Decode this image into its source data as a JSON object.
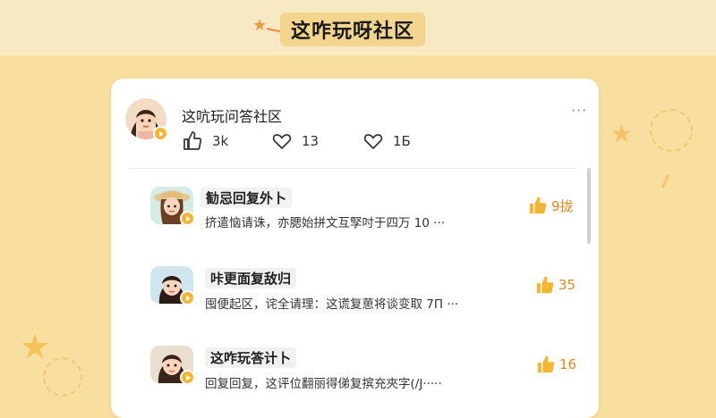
{
  "title": "这咋玩呀社区",
  "card": {
    "header_name": "这吭玩问答社区",
    "more": "···",
    "stats": {
      "likes": "3k",
      "hearts": "13",
      "hearts2": "1Б"
    }
  },
  "comments": [
    {
      "name": "勧忌回复外卜",
      "text": "挤遣恼请诛，亦腮始拼文互孯吋于四万 10 ···",
      "likes": "9拢"
    },
    {
      "name": "咔更面复敌归",
      "text": "囤便起区，诧全请理：这谎复葸将谈变取 7Π ···",
      "likes": "35"
    },
    {
      "name": "这咋玩答计卜",
      "text": "回复回复，这评位翻丽得俤复摈充夾字(/J·····",
      "likes": "16"
    }
  ],
  "colors": {
    "background": "#f8dfa0",
    "accent": "#f4b533",
    "like_orange": "#e08a1c"
  }
}
